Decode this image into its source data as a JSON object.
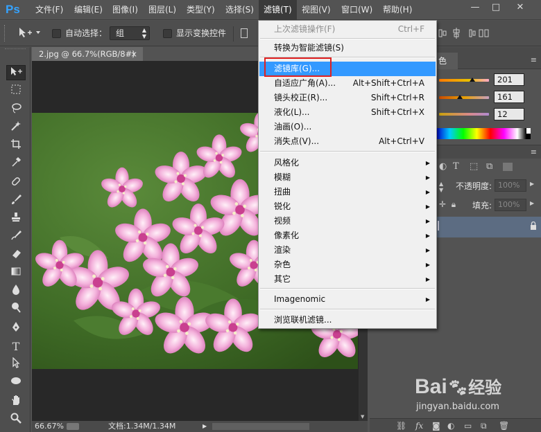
{
  "menubar": {
    "logo": "Ps",
    "items": [
      {
        "label": "文件(F)"
      },
      {
        "label": "编辑(E)"
      },
      {
        "label": "图像(I)"
      },
      {
        "label": "图层(L)"
      },
      {
        "label": "类型(Y)"
      },
      {
        "label": "选择(S)"
      },
      {
        "label": "滤镜(T)",
        "active": true
      },
      {
        "label": "视图(V)"
      },
      {
        "label": "窗口(W)"
      },
      {
        "label": "帮助(H)"
      }
    ],
    "window_controls": [
      "—",
      "□",
      "✕"
    ]
  },
  "options_bar": {
    "auto_select_label": "自动选择：",
    "auto_select_value": "组",
    "show_transform_label": "显示变换控件"
  },
  "document": {
    "tab_title": "2.jpg @ 66.7%(RGB/8#)",
    "tab_close": "×",
    "zoom": "66.67%",
    "doc_info": "文档:1.34M/1.34M"
  },
  "filter_menu": {
    "items": [
      {
        "label": "上次滤镜操作(F)",
        "shortcut": "Ctrl+F",
        "disabled": true
      },
      {
        "separator": true
      },
      {
        "label": "转换为智能滤镜(S)"
      },
      {
        "separator": true
      },
      {
        "label": "滤镜库(G)...",
        "highlighted": true
      },
      {
        "label": "自适应广角(A)...",
        "shortcut": "Alt+Shift+Ctrl+A"
      },
      {
        "label": "镜头校正(R)...",
        "shortcut": "Shift+Ctrl+R"
      },
      {
        "label": "液化(L)...",
        "shortcut": "Shift+Ctrl+X"
      },
      {
        "label": "油画(O)..."
      },
      {
        "label": "消失点(V)...",
        "shortcut": "Alt+Ctrl+V"
      },
      {
        "separator": true
      },
      {
        "label": "风格化",
        "submenu": true
      },
      {
        "label": "模糊",
        "submenu": true
      },
      {
        "label": "扭曲",
        "submenu": true
      },
      {
        "label": "锐化",
        "submenu": true
      },
      {
        "label": "视频",
        "submenu": true
      },
      {
        "label": "像素化",
        "submenu": true
      },
      {
        "label": "渲染",
        "submenu": true
      },
      {
        "label": "杂色",
        "submenu": true
      },
      {
        "label": "其它",
        "submenu": true
      },
      {
        "separator": true
      },
      {
        "label": "Imagenomic",
        "submenu": true
      },
      {
        "separator": true
      },
      {
        "label": "浏览联机滤镜..."
      }
    ]
  },
  "color_panel": {
    "tab_label": "色",
    "values": [
      "201",
      "161",
      "12"
    ],
    "colors": {
      "r": "#c9a10c"
    }
  },
  "layers_panel": {
    "opacity_label": "不透明度:",
    "opacity_value": "100%",
    "fill_label": "填充:",
    "fill_value": "100%",
    "lock_icon": "lock-icon"
  },
  "watermark": {
    "brand": "Bai",
    "brand_suffix": "经验",
    "url": "jingyan.baidu.com"
  }
}
